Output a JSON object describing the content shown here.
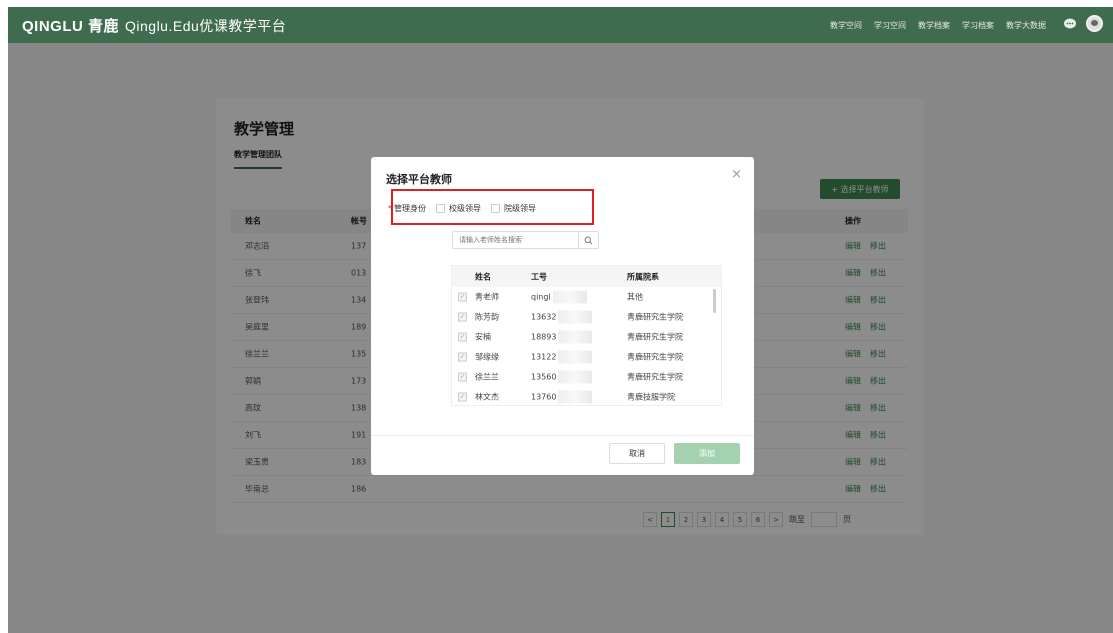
{
  "topbar": {
    "logo_brand": "QINGLU 青鹿",
    "logo_sub": "Qinglu.Edu优课教学平台",
    "nav": [
      "教学空间",
      "学习空间",
      "教学档案",
      "学习档案",
      "教学大数据"
    ]
  },
  "page": {
    "title": "教学管理",
    "tab": "教学管理团队",
    "add_button": "+ 选择平台教师",
    "columns": {
      "name": "姓名",
      "account": "帐号",
      "op": "操作"
    },
    "rows": [
      {
        "name": "邓志滔",
        "account": "137"
      },
      {
        "name": "徐飞",
        "account": "013"
      },
      {
        "name": "张登玮",
        "account": "134"
      },
      {
        "name": "吴庭里",
        "account": "189"
      },
      {
        "name": "徐兰兰",
        "account": "135"
      },
      {
        "name": "郭娟",
        "account": "173"
      },
      {
        "name": "高玟",
        "account": "138"
      },
      {
        "name": "刘飞",
        "account": "191"
      },
      {
        "name": "梁玉贵",
        "account": "183"
      },
      {
        "name": "毕南总",
        "account": "186"
      }
    ],
    "op_edit": "编辑",
    "op_remove": "移出",
    "pager": {
      "prev": "<",
      "pages": [
        "1",
        "2",
        "3",
        "4",
        "5",
        "6"
      ],
      "next": ">",
      "goto": "跳至",
      "unit": "页"
    }
  },
  "modal": {
    "title": "选择平台教师",
    "close": "×",
    "required_mark": "*",
    "role_label": "管理身份",
    "roles": [
      "校级领导",
      "院级领导"
    ],
    "search_placeholder": "请输入老师姓名搜索",
    "columns": {
      "name": "姓名",
      "id": "工号",
      "dept": "所属院系"
    },
    "teachers": [
      {
        "name": "青老师",
        "id": "qingl",
        "dept": "其他"
      },
      {
        "name": "陈芳韵",
        "id": "13632",
        "dept": "青鹿研究生学院"
      },
      {
        "name": "安楠",
        "id": "18893",
        "dept": "青鹿研究生学院"
      },
      {
        "name": "邹缘缘",
        "id": "13122",
        "dept": "青鹿研究生学院"
      },
      {
        "name": "徐兰兰",
        "id": "13560",
        "dept": "青鹿研究生学院"
      },
      {
        "name": "林文杰",
        "id": "13760",
        "dept": "青鹿技服学院"
      }
    ],
    "cancel": "取消",
    "confirm": "添加"
  }
}
